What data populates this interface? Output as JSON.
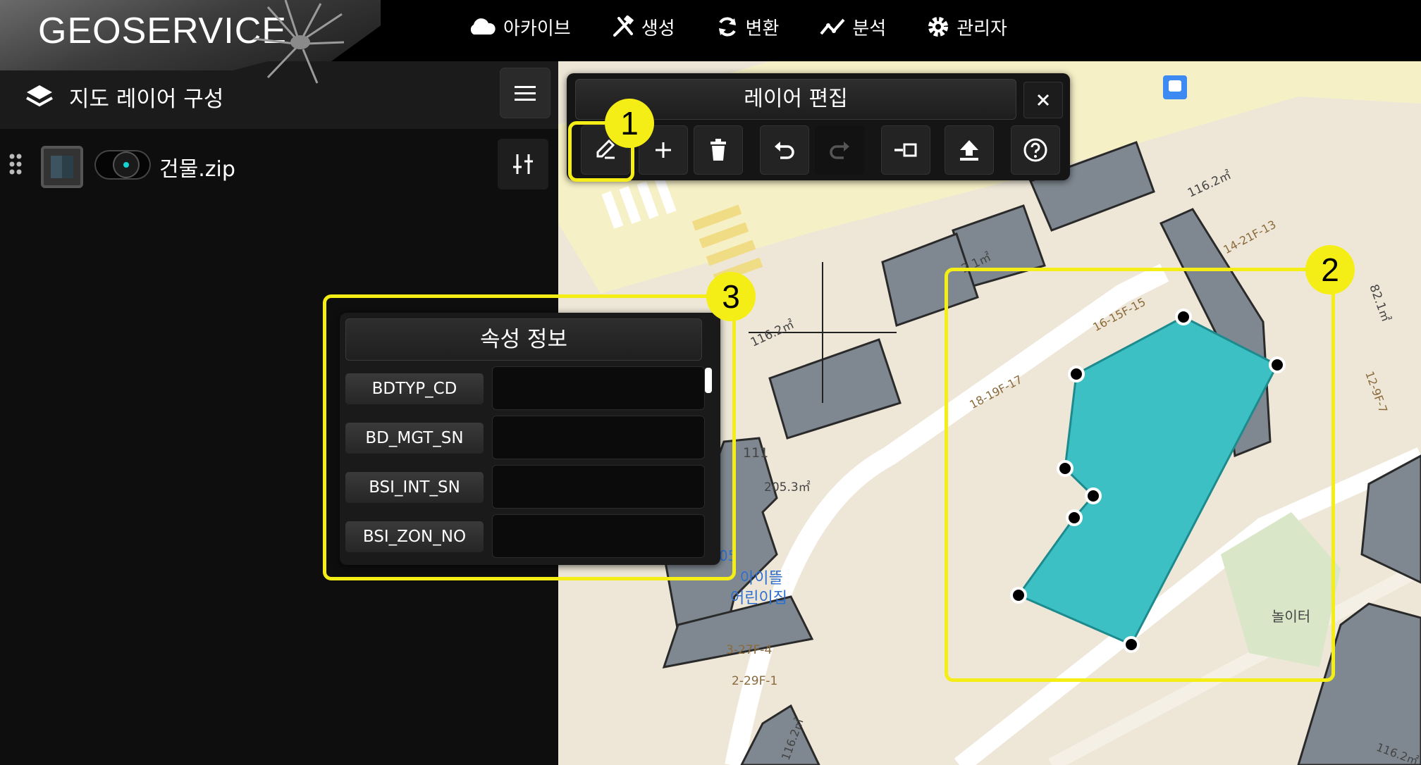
{
  "app": {
    "logo": "GEOSERVICE"
  },
  "nav": [
    {
      "label": "아카이브",
      "icon": "cloud-icon"
    },
    {
      "label": "생성",
      "icon": "tools-icon"
    },
    {
      "label": "변환",
      "icon": "refresh-icon"
    },
    {
      "label": "분석",
      "icon": "chart-line-icon"
    },
    {
      "label": "관리자",
      "icon": "gear-icon"
    }
  ],
  "sidebar": {
    "title": "지도 레이어 구성",
    "layers": [
      {
        "name": "건물.zip",
        "visible": true
      }
    ]
  },
  "edit_panel": {
    "title": "레이어 편집",
    "tools": [
      "edit-icon",
      "plus-icon",
      "trash-icon",
      "undo-icon",
      "redo-icon",
      "split-icon",
      "upload-icon",
      "help-icon"
    ]
  },
  "attribute_panel": {
    "title": "속성 정보",
    "fields": [
      {
        "label": "BDTYP_CD",
        "value": ""
      },
      {
        "label": "BD_MGT_SN",
        "value": ""
      },
      {
        "label": "BSI_INT_SN",
        "value": ""
      },
      {
        "label": "BSI_ZON_NO",
        "value": ""
      }
    ]
  },
  "map_labels": {
    "area1": "116.2㎡",
    "area2": "2.1㎡",
    "area3": "116.2㎡",
    "area4": "82.1㎡",
    "area5": "205.3㎡",
    "area6": "116.2㎡",
    "area7": "116.2㎡",
    "bld111": "111",
    "poi_name1": "아이뜰",
    "poi_name2": "어린이집",
    "poi_fragment": "05",
    "lot1": "14-21F-13",
    "lot2": "16-15F-15",
    "lot3": "18-19F-17",
    "lot4": "12-9F-7",
    "lot5": "3-27F-4",
    "lot6": "2-29F-1",
    "playground": "놀이터"
  },
  "callouts": [
    "1",
    "2",
    "3"
  ],
  "colors": {
    "accent": "#f5ee16",
    "polygon": "#3cc0c4",
    "building": "#7f8891"
  }
}
